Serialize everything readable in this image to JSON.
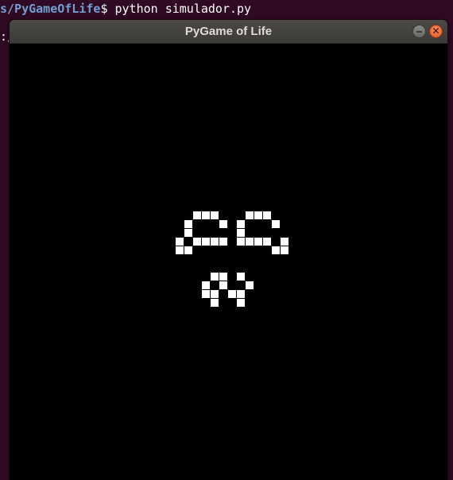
{
  "terminal": {
    "path": "s/PyGameOfLife",
    "prompt_suffix": "$ ",
    "command": "python simulador.py",
    "prompt2": ":/"
  },
  "window": {
    "title": "PyGame of Life",
    "minimize_glyph": "",
    "close_glyph": "✕"
  },
  "game": {
    "live_cells": [
      [
        21,
        0
      ],
      [
        22,
        0
      ],
      [
        23,
        0
      ],
      [
        27,
        0
      ],
      [
        28,
        0
      ],
      [
        29,
        0
      ],
      [
        20,
        1
      ],
      [
        24,
        1
      ],
      [
        26,
        1
      ],
      [
        30,
        1
      ],
      [
        20,
        2
      ],
      [
        26,
        2
      ],
      [
        19,
        3
      ],
      [
        21,
        3
      ],
      [
        22,
        3
      ],
      [
        23,
        3
      ],
      [
        24,
        3
      ],
      [
        26,
        3
      ],
      [
        27,
        3
      ],
      [
        28,
        3
      ],
      [
        29,
        3
      ],
      [
        31,
        3
      ],
      [
        19,
        4
      ],
      [
        20,
        4
      ],
      [
        30,
        4
      ],
      [
        31,
        4
      ],
      [
        23,
        7
      ],
      [
        24,
        7
      ],
      [
        26,
        7
      ],
      [
        22,
        8
      ],
      [
        24,
        8
      ],
      [
        27,
        8
      ],
      [
        22,
        9
      ],
      [
        23,
        9
      ],
      [
        25,
        9
      ],
      [
        26,
        9
      ],
      [
        23,
        10
      ],
      [
        26,
        10
      ]
    ]
  }
}
